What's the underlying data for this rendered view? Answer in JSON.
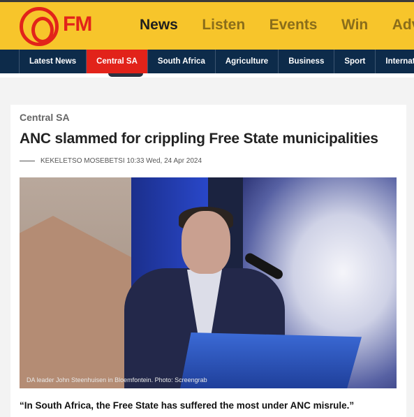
{
  "header": {
    "logo_text": "FM",
    "nav": [
      {
        "label": "News",
        "active": true
      },
      {
        "label": "Listen",
        "active": false
      },
      {
        "label": "Events",
        "active": false
      },
      {
        "label": "Win",
        "active": false
      },
      {
        "label": "Adve",
        "active": false
      }
    ]
  },
  "subnav": {
    "items": [
      {
        "label": "Latest News",
        "active": false
      },
      {
        "label": "Central SA",
        "active": true
      },
      {
        "label": "South Africa",
        "active": false
      },
      {
        "label": "Agriculture",
        "active": false
      },
      {
        "label": "Business",
        "active": false
      },
      {
        "label": "Sport",
        "active": false
      },
      {
        "label": "Internat",
        "active": false
      }
    ]
  },
  "article": {
    "category": "Central SA",
    "title": "ANC slammed for crippling Free State municipalities",
    "author": "KEKELETSO MOSEBETSI",
    "datetime": "10:33 Wed, 24 Apr 2024",
    "image_caption": "DA leader John Steenhuisen in Bloemfontein. Photo: Screengrab",
    "lead_quote": "“In South Africa, the Free State has suffered the most under ANC misrule.”"
  },
  "colors": {
    "brand_yellow": "#f7c52b",
    "brand_red": "#e2231a",
    "nav_navy": "#0d2b4a"
  }
}
